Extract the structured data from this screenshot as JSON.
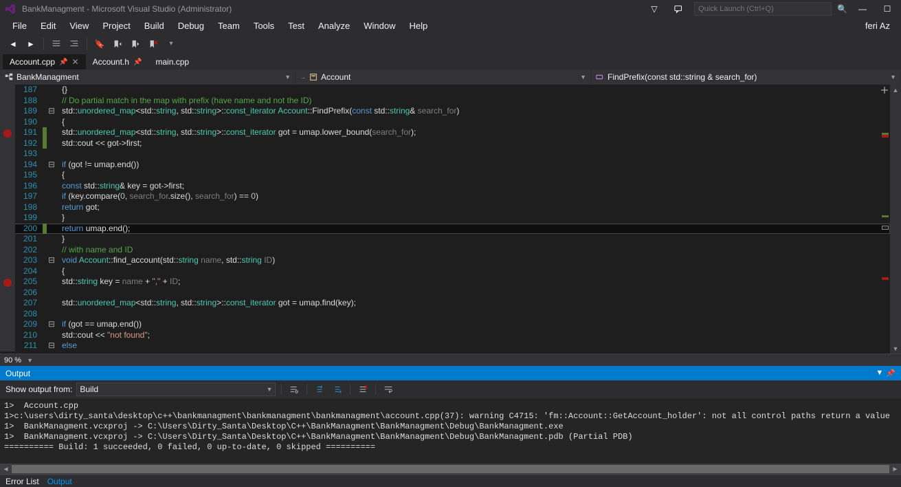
{
  "title": "BankManagment - Microsoft Visual Studio (Administrator)",
  "quickLaunchPlaceholder": "Quick Launch (Ctrl+Q)",
  "user": "feri Az",
  "menus": [
    "File",
    "Edit",
    "View",
    "Project",
    "Build",
    "Debug",
    "Team",
    "Tools",
    "Test",
    "Analyze",
    "Window",
    "Help"
  ],
  "tabs": [
    {
      "label": "Account.cpp",
      "active": true,
      "pinned": true
    },
    {
      "label": "Account.h",
      "active": false,
      "pinned": true
    },
    {
      "label": "main.cpp",
      "active": false,
      "pinned": false
    }
  ],
  "nav": {
    "project": "BankManagment",
    "class": "Account",
    "member": "FindPrefix(const std::string & search_for)"
  },
  "code": {
    "start": 187,
    "lines": [
      {
        "n": 187,
        "f": "",
        "t": [
          [
            "w",
            "    {}"
          ]
        ]
      },
      {
        "n": 188,
        "f": "",
        "t": [
          [
            "w",
            "    "
          ],
          [
            "cm",
            "// Do partial match in the map with prefix (have name and not the ID)"
          ]
        ]
      },
      {
        "n": 189,
        "f": "⊟",
        "t": [
          [
            "w",
            "std::"
          ],
          [
            "cl",
            "unordered_map"
          ],
          [
            "w",
            "<std::"
          ],
          [
            "cl",
            "string"
          ],
          [
            "w",
            ", std::"
          ],
          [
            "cl",
            "string"
          ],
          [
            "w",
            ">::"
          ],
          [
            "cl",
            "const_iterator"
          ],
          [
            "w",
            " "
          ],
          [
            "cl",
            "Account"
          ],
          [
            "w",
            "::FindPrefix("
          ],
          [
            "k",
            "const"
          ],
          [
            "w",
            " std::"
          ],
          [
            "cl",
            "string"
          ],
          [
            "w",
            "& "
          ],
          [
            "p",
            "search_for"
          ],
          [
            "w",
            ")"
          ]
        ]
      },
      {
        "n": 190,
        "f": "",
        "t": [
          [
            "w",
            "{"
          ]
        ]
      },
      {
        "n": 191,
        "f": "",
        "bp": true,
        "m": "c",
        "t": [
          [
            "w",
            "    std::"
          ],
          [
            "cl",
            "unordered_map"
          ],
          [
            "w",
            "<std::"
          ],
          [
            "cl",
            "string"
          ],
          [
            "w",
            ", std::"
          ],
          [
            "cl",
            "string"
          ],
          [
            "w",
            ">::"
          ],
          [
            "cl",
            "const_iterator"
          ],
          [
            "w",
            " got = umap.lower_bound("
          ],
          [
            "p",
            "search_for"
          ],
          [
            "w",
            ");"
          ]
        ]
      },
      {
        "n": 192,
        "f": "",
        "m": "c",
        "t": [
          [
            "w",
            "    std::cout << got->first;"
          ]
        ]
      },
      {
        "n": 193,
        "f": "",
        "t": [
          [
            "w",
            ""
          ]
        ]
      },
      {
        "n": 194,
        "f": "⊟",
        "t": [
          [
            "w",
            "    "
          ],
          [
            "k",
            "if"
          ],
          [
            "w",
            " (got != umap.end())"
          ]
        ]
      },
      {
        "n": 195,
        "f": "",
        "t": [
          [
            "w",
            "    {"
          ]
        ]
      },
      {
        "n": 196,
        "f": "",
        "t": [
          [
            "w",
            "        "
          ],
          [
            "k",
            "const"
          ],
          [
            "w",
            " std::"
          ],
          [
            "cl",
            "string"
          ],
          [
            "w",
            "& key = got->first;"
          ]
        ]
      },
      {
        "n": 197,
        "f": "",
        "t": [
          [
            "w",
            "        "
          ],
          [
            "k",
            "if"
          ],
          [
            "w",
            " (key.compare("
          ],
          [
            "n",
            "0"
          ],
          [
            "w",
            ", "
          ],
          [
            "p",
            "search_for"
          ],
          [
            "w",
            ".size(), "
          ],
          [
            "p",
            "search_for"
          ],
          [
            "w",
            ") == "
          ],
          [
            "n",
            "0"
          ],
          [
            "w",
            ")"
          ]
        ]
      },
      {
        "n": 198,
        "f": "",
        "t": [
          [
            "w",
            "            "
          ],
          [
            "k",
            "return"
          ],
          [
            "w",
            " got;"
          ]
        ]
      },
      {
        "n": 199,
        "f": "",
        "t": [
          [
            "w",
            "    }"
          ]
        ]
      },
      {
        "n": 200,
        "f": "",
        "hl": true,
        "m": "c",
        "t": [
          [
            "w",
            "    "
          ],
          [
            "k",
            "return"
          ],
          [
            "w",
            " umap.end();"
          ]
        ]
      },
      {
        "n": 201,
        "f": "",
        "t": [
          [
            "w",
            "}"
          ]
        ]
      },
      {
        "n": 202,
        "f": "",
        "t": [
          [
            "w",
            "    "
          ],
          [
            "cm",
            "// with name and ID"
          ]
        ]
      },
      {
        "n": 203,
        "f": "⊟",
        "t": [
          [
            "k",
            "void"
          ],
          [
            "w",
            " "
          ],
          [
            "cl",
            "Account"
          ],
          [
            "w",
            "::find_account(std::"
          ],
          [
            "cl",
            "string"
          ],
          [
            "w",
            " "
          ],
          [
            "p",
            "name"
          ],
          [
            "w",
            ", std::"
          ],
          [
            "cl",
            "string"
          ],
          [
            "w",
            " "
          ],
          [
            "p",
            "ID"
          ],
          [
            "w",
            ")"
          ]
        ]
      },
      {
        "n": 204,
        "f": "",
        "t": [
          [
            "w",
            "{"
          ]
        ]
      },
      {
        "n": 205,
        "f": "",
        "bp": true,
        "t": [
          [
            "w",
            "    std::"
          ],
          [
            "cl",
            "string"
          ],
          [
            "w",
            " key = "
          ],
          [
            "p",
            "name"
          ],
          [
            "w",
            " + "
          ],
          [
            "s",
            "\",\""
          ],
          [
            "w",
            " + "
          ],
          [
            "p",
            "ID"
          ],
          [
            "w",
            ";"
          ]
        ]
      },
      {
        "n": 206,
        "f": "",
        "t": [
          [
            "w",
            ""
          ]
        ]
      },
      {
        "n": 207,
        "f": "",
        "t": [
          [
            "w",
            "    std::"
          ],
          [
            "cl",
            "unordered_map"
          ],
          [
            "w",
            "<std::"
          ],
          [
            "cl",
            "string"
          ],
          [
            "w",
            ", std::"
          ],
          [
            "cl",
            "string"
          ],
          [
            "w",
            ">::"
          ],
          [
            "cl",
            "const_iterator"
          ],
          [
            "w",
            " got = umap.find(key);"
          ]
        ]
      },
      {
        "n": 208,
        "f": "",
        "t": [
          [
            "w",
            ""
          ]
        ]
      },
      {
        "n": 209,
        "f": "⊟",
        "t": [
          [
            "w",
            "    "
          ],
          [
            "k",
            "if"
          ],
          [
            "w",
            " (got == umap.end())"
          ]
        ]
      },
      {
        "n": 210,
        "f": "",
        "t": [
          [
            "w",
            "        std::cout << "
          ],
          [
            "s",
            "\"not found\""
          ],
          [
            "w",
            ";"
          ]
        ]
      },
      {
        "n": 211,
        "f": "⊟",
        "t": [
          [
            "w",
            "    "
          ],
          [
            "k",
            "else"
          ]
        ]
      }
    ]
  },
  "zoom": "90 %",
  "output": {
    "label": "Output",
    "showFrom": "Show output from:",
    "source": "Build",
    "lines": [
      "1>  Account.cpp",
      "1>c:\\users\\dirty_santa\\desktop\\c++\\bankmanagment\\bankmanagment\\bankmanagment\\account.cpp(37): warning C4715: 'fm::Account::GetAccount_holder': not all control paths return a value",
      "1>  BankManagment.vcxproj -> C:\\Users\\Dirty_Santa\\Desktop\\C++\\BankManagment\\BankManagment\\Debug\\BankManagment.exe",
      "1>  BankManagment.vcxproj -> C:\\Users\\Dirty_Santa\\Desktop\\C++\\BankManagment\\BankManagment\\Debug\\BankManagment.pdb (Partial PDB)",
      "========== Build: 1 succeeded, 0 failed, 0 up-to-date, 0 skipped =========="
    ]
  },
  "bottomTabs": [
    "Error List",
    "Output"
  ]
}
